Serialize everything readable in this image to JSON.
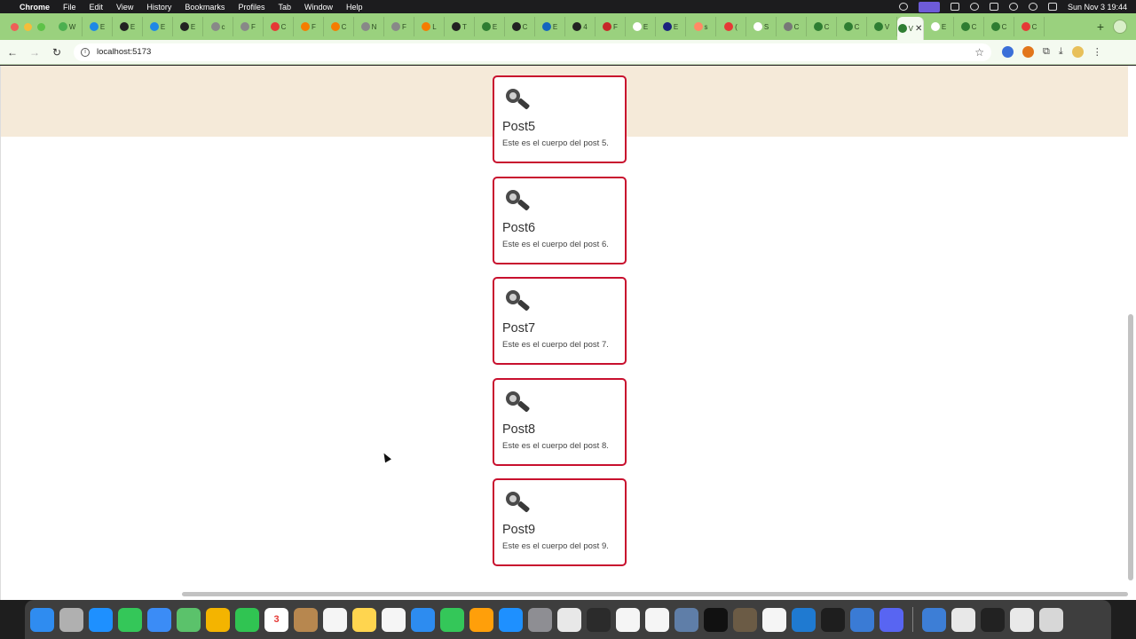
{
  "menubar": {
    "app_name": "Chrome",
    "menus": [
      "File",
      "Edit",
      "View",
      "History",
      "Bookmarks",
      "Profiles",
      "Tab",
      "Window",
      "Help"
    ],
    "clock": "Sun Nov 3  19:44"
  },
  "tabstrip": {
    "tabs": [
      {
        "icon": "website-icon",
        "letter": "W",
        "color": "#4caf50"
      },
      {
        "icon": "graduation-cap-icon",
        "letter": "E",
        "color": "#1e88e5"
      },
      {
        "icon": "github-icon",
        "letter": "E",
        "color": "#222222"
      },
      {
        "icon": "graduation-cap-icon",
        "letter": "E",
        "color": "#1e88e5"
      },
      {
        "icon": "github-icon",
        "letter": "E",
        "color": "#222222"
      },
      {
        "icon": "web-icon",
        "letter": "c",
        "color": "#888888"
      },
      {
        "icon": "web-icon",
        "letter": "F",
        "color": "#888888"
      },
      {
        "icon": "youtube-icon",
        "letter": "C",
        "color": "#e53935"
      },
      {
        "icon": "flame-icon",
        "letter": "F",
        "color": "#f57c00"
      },
      {
        "icon": "flame-icon",
        "letter": "C",
        "color": "#f57c00"
      },
      {
        "icon": "web-icon",
        "letter": "N",
        "color": "#888888"
      },
      {
        "icon": "web-icon",
        "letter": "F",
        "color": "#888888"
      },
      {
        "icon": "flame-icon",
        "letter": "L",
        "color": "#f57c00"
      },
      {
        "icon": "github-icon",
        "letter": "T",
        "color": "#222222"
      },
      {
        "icon": "web-icon",
        "letter": "E",
        "color": "#2e7d32"
      },
      {
        "icon": "github-icon",
        "letter": "C",
        "color": "#222222"
      },
      {
        "icon": "web-icon",
        "letter": "E",
        "color": "#1565c0"
      },
      {
        "icon": "github-icon",
        "letter": "4",
        "color": "#222222"
      },
      {
        "icon": "red-square-icon",
        "letter": "F",
        "color": "#c62828"
      },
      {
        "icon": "google-icon",
        "letter": "E",
        "color": "#ffffff"
      },
      {
        "icon": "bracket-icon",
        "letter": "E",
        "color": "#1a237e"
      },
      {
        "icon": "web-icon",
        "letter": "s",
        "color": "#ff8a65"
      },
      {
        "icon": "youtube-icon",
        "letter": "(",
        "color": "#e53935"
      },
      {
        "icon": "google-icon",
        "letter": "S",
        "color": "#ffffff"
      },
      {
        "icon": "circle-icon",
        "letter": "C",
        "color": "#777777"
      },
      {
        "icon": "v-icon",
        "letter": "C",
        "color": "#2e7d32"
      },
      {
        "icon": "v-icon",
        "letter": "C",
        "color": "#2e7d32"
      },
      {
        "icon": "w-icon",
        "letter": "V",
        "color": "#2e7d32"
      }
    ],
    "active_tab": {
      "icon": "v-icon",
      "letter": "V",
      "color": "#2e7d32"
    },
    "tabs_after": [
      {
        "icon": "google-icon",
        "letter": "E",
        "color": "#ffffff"
      },
      {
        "icon": "v-icon",
        "letter": "C",
        "color": "#2e7d32"
      },
      {
        "icon": "v-icon",
        "letter": "C",
        "color": "#2e7d32"
      },
      {
        "icon": "youtube-icon",
        "letter": "C",
        "color": "#e53935"
      }
    ],
    "close_glyph": "✕",
    "new_tab_glyph": "+"
  },
  "toolbar": {
    "url": "localhost:5173",
    "back_glyph": "←",
    "forward_glyph": "→",
    "reload_glyph": "↻",
    "info_glyph": "i",
    "star_glyph": "☆",
    "menu_glyph": "⋮",
    "download_glyph": "⤓",
    "extensions_glyph": "⧉"
  },
  "posts": [
    {
      "title": "Post5",
      "body": "Este es el cuerpo del post 5."
    },
    {
      "title": "Post6",
      "body": "Este es el cuerpo del post 6."
    },
    {
      "title": "Post7",
      "body": "Este es el cuerpo del post 7."
    },
    {
      "title": "Post8",
      "body": "Este es el cuerpo del post 8."
    },
    {
      "title": "Post9",
      "body": "Este es el cuerpo del post 9."
    }
  ],
  "colors": {
    "tabstrip_bg": "#9ad17e",
    "hero_band": "#f5ead9",
    "card_border": "#c8102e"
  },
  "dock": {
    "apps": [
      {
        "name": "finder-icon",
        "color": "#2f8cf0"
      },
      {
        "name": "launchpad-icon",
        "color": "#b0b0b0"
      },
      {
        "name": "safari-icon",
        "color": "#1e90ff"
      },
      {
        "name": "messages-icon",
        "color": "#34c759"
      },
      {
        "name": "mail-icon",
        "color": "#3b8cf6"
      },
      {
        "name": "maps-icon",
        "color": "#5bc26b"
      },
      {
        "name": "photos-icon",
        "color": "#f4b400"
      },
      {
        "name": "facetime-icon",
        "color": "#30c452"
      },
      {
        "name": "calendar-icon",
        "color": "#ffffff",
        "label": "3"
      },
      {
        "name": "contacts-icon",
        "color": "#b7874f"
      },
      {
        "name": "reminders-icon",
        "color": "#f5f5f5"
      },
      {
        "name": "notes-icon",
        "color": "#ffd54f"
      },
      {
        "name": "freeform-icon",
        "color": "#f5f5f5"
      },
      {
        "name": "keynote-icon",
        "color": "#2d8cf0"
      },
      {
        "name": "numbers-icon",
        "color": "#34c759"
      },
      {
        "name": "pages-icon",
        "color": "#ff9f0a"
      },
      {
        "name": "app-store-icon",
        "color": "#1e90ff"
      },
      {
        "name": "system-settings-icon",
        "color": "#8e8e93"
      },
      {
        "name": "chrome-icon",
        "color": "#e8e8e8"
      },
      {
        "name": "obs-icon",
        "color": "#2b2b2b"
      },
      {
        "name": "google-drive-icon",
        "color": "#f5f5f5"
      },
      {
        "name": "xcode-instruments-icon",
        "color": "#f5f5f5"
      },
      {
        "name": "docker-icon",
        "color": "#5f7ea8"
      },
      {
        "name": "intellij-icon",
        "color": "#111111"
      },
      {
        "name": "gimp-icon",
        "color": "#6b5b45"
      },
      {
        "name": "chatgpt-icon",
        "color": "#f5f5f5"
      },
      {
        "name": "vscode-icon",
        "color": "#1f7ad1"
      },
      {
        "name": "terminal-icon",
        "color": "#1e1e1e"
      },
      {
        "name": "xcode-icon",
        "color": "#3a7bd5"
      },
      {
        "name": "discord-icon",
        "color": "#5865f2"
      }
    ],
    "apps_right": [
      {
        "name": "preview-icon",
        "color": "#3d7ed6"
      },
      {
        "name": "chrome-icon",
        "color": "#e8e8e8"
      },
      {
        "name": "quicktime-icon",
        "color": "#222222"
      },
      {
        "name": "documents-icon",
        "color": "#e9e9e9"
      },
      {
        "name": "trash-icon",
        "color": "#d7d7d7"
      }
    ]
  }
}
